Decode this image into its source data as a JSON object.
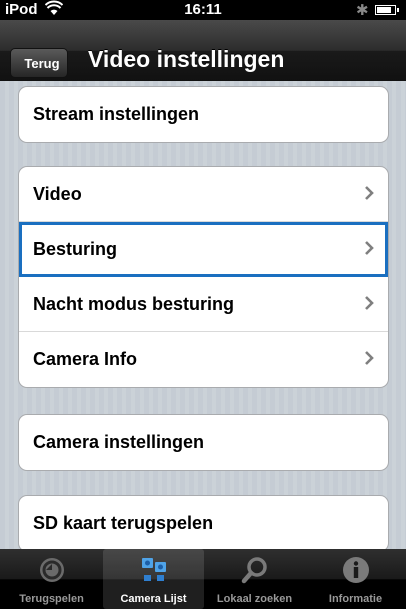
{
  "status_bar": {
    "carrier": "iPod",
    "time": "16:11",
    "battery_level": 0.85
  },
  "nav": {
    "back_label": "Terug",
    "title": "Video instellingen"
  },
  "groups": [
    {
      "rows": [
        {
          "label": "Stream instellingen",
          "chevron": false
        }
      ]
    },
    {
      "rows": [
        {
          "label": "Video",
          "chevron": true
        },
        {
          "label": "Besturing",
          "chevron": true,
          "selected": true
        },
        {
          "label": "Nacht modus besturing",
          "chevron": true
        },
        {
          "label": "Camera Info",
          "chevron": true
        }
      ]
    },
    {
      "rows": [
        {
          "label": "Camera instellingen",
          "chevron": false
        }
      ]
    },
    {
      "rows": [
        {
          "label": "SD kaart terugspelen",
          "chevron": false
        }
      ]
    }
  ],
  "tabs": [
    {
      "label": "Terugspelen",
      "icon": "playback-icon",
      "active": false
    },
    {
      "label": "Camera Lijst",
      "icon": "camera-list-icon",
      "active": true
    },
    {
      "label": "Lokaal zoeken",
      "icon": "search-icon",
      "active": false
    },
    {
      "label": "Informatie",
      "icon": "info-icon",
      "active": false
    }
  ],
  "colors": {
    "selection": "#1a6fc0",
    "background": "#c5ccd4"
  }
}
